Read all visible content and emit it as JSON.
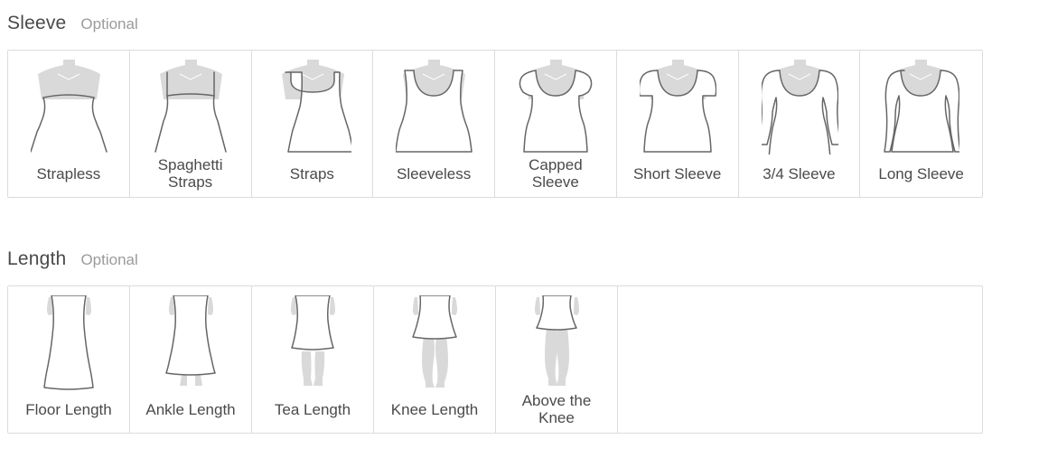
{
  "sleeve": {
    "title": "Sleeve",
    "optional": "Optional",
    "options": [
      {
        "label": "Strapless"
      },
      {
        "label": "Spaghetti Straps"
      },
      {
        "label": "Straps"
      },
      {
        "label": "Sleeveless"
      },
      {
        "label": "Capped Sleeve"
      },
      {
        "label": "Short Sleeve"
      },
      {
        "label": "3/4 Sleeve"
      },
      {
        "label": "Long Sleeve"
      }
    ]
  },
  "length": {
    "title": "Length",
    "optional": "Optional",
    "options": [
      {
        "label": "Floor Length"
      },
      {
        "label": "Ankle Length"
      },
      {
        "label": "Tea Length"
      },
      {
        "label": "Knee Length"
      },
      {
        "label": "Above the Knee"
      }
    ]
  },
  "colors": {
    "border": "#dcdcdc",
    "text": "#4a4a4a",
    "muted": "#9b9b9b",
    "skin": "#d9d9d9"
  }
}
